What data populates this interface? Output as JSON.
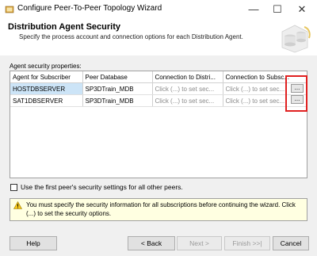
{
  "window": {
    "title": "Configure Peer-To-Peer Topology Wizard",
    "minimize_glyph": "—",
    "maximize_glyph": "☐",
    "close_glyph": "✕"
  },
  "header": {
    "title": "Distribution Agent Security",
    "subtitle": "Specify the process account and connection options for each Distribution Agent."
  },
  "grid": {
    "label": "Agent security properties:",
    "columns": [
      "Agent for Subscriber",
      "Peer Database",
      "Connection to Distri...",
      "Connection to Subsc..."
    ],
    "rows": [
      {
        "agent": "HOSTDBSERVER",
        "db": "SP3DTrain_MDB",
        "conn_dist": "Click (...) to set sec...",
        "conn_sub": "Click (...) to set sec..."
      },
      {
        "agent": "SAT1DBSERVER",
        "db": "SP3DTrain_MDB",
        "conn_dist": "Click (...) to set sec...",
        "conn_sub": "Click (...) to set sec..."
      }
    ],
    "ellipsis": "..."
  },
  "checkbox": {
    "label": "Use the first peer's security settings for all other peers.",
    "checked": false
  },
  "warning": {
    "text": "You must specify the security information for all subscriptions before continuing the wizard. Click (...) to set the security options."
  },
  "buttons": {
    "help": "Help",
    "back": "< Back",
    "next": "Next >",
    "finish": "Finish >>|",
    "cancel": "Cancel"
  },
  "colors": {
    "highlight_box": "#e02020",
    "selected_row": "#cce4f7",
    "warning_bg": "#ffffe1"
  },
  "icons": [
    "wizard-app-icon",
    "database-wizard-graphic",
    "warning-icon"
  ]
}
